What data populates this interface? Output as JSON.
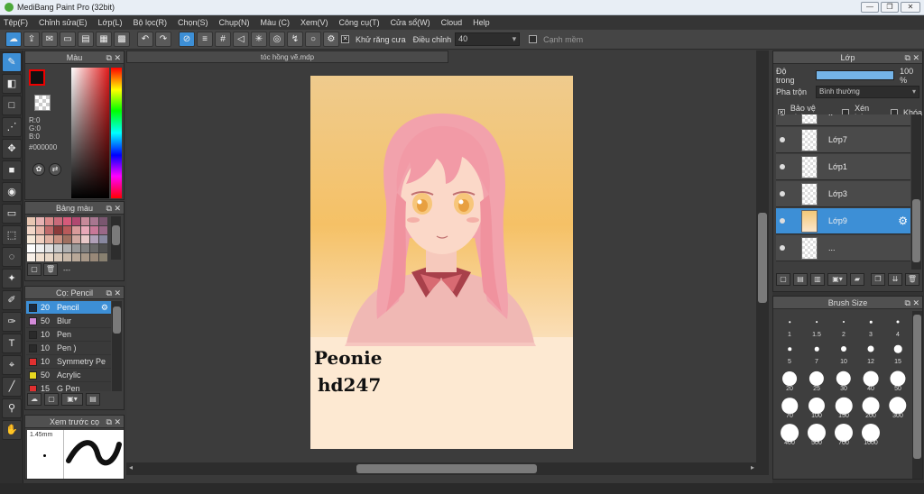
{
  "window": {
    "title": "MediBang Paint Pro (32bit)",
    "minimize": "—",
    "restore": "❐",
    "close": "✕"
  },
  "menu": [
    "Tệp(F)",
    "Chỉnh sửa(E)",
    "Lớp(L)",
    "Bộ lọc(R)",
    "Chọn(S)",
    "Chụp(N)",
    "Màu (C)",
    "Xem(V)",
    "Công cụ(T)",
    "Cửa sổ(W)",
    "Cloud",
    "Help"
  ],
  "toolbar": {
    "antialias_label": "Khử răng cưa",
    "correction_label": "Điều chỉnh",
    "correction_value": "40",
    "edge_label": "Cạnh mềm"
  },
  "color_panel": {
    "title": "Màu",
    "r": "R:0",
    "g": "G:0",
    "b": "B:0",
    "hex": "#000000"
  },
  "palette_panel": {
    "title": "Bảng màu",
    "dashes": "---",
    "swatches": [
      "#e8c7b3",
      "#e7b3b3",
      "#d98a8a",
      "#c96a7a",
      "#d65a7a",
      "#b04870",
      "#c78a9a",
      "#a87690",
      "#7a5670",
      "#f2d7c8",
      "#e8b5a8",
      "#c06a6a",
      "#8b3a3a",
      "#b85a5a",
      "#d89a9a",
      "#e8a8b8",
      "#c87898",
      "#9a6888",
      "#f6e8d8",
      "#f0d0c0",
      "#e0b0a0",
      "#c89080",
      "#a07060",
      "#d0a8a0",
      "#e8c8c8",
      "#b0a0b8",
      "#8888a0",
      "#ffffff",
      "#f0f0f0",
      "#e0e0e0",
      "#c8c8c8",
      "#b0b0b0",
      "#989898",
      "#808080",
      "#686868",
      "#505050",
      "#f8f0e8",
      "#f0e0d0",
      "#e8d8c8",
      "#d8c8b8",
      "#c8b8a8",
      "#b8a898",
      "#a89888",
      "#988878",
      "#888070"
    ]
  },
  "brush_panel": {
    "title": "Cọ: Pencil",
    "items": [
      {
        "size": "20",
        "name": "Pencil",
        "color": "#1a2a40"
      },
      {
        "size": "50",
        "name": "Blur",
        "color": "#d28ad8"
      },
      {
        "size": "10",
        "name": "Pen",
        "color": "#2a2a2a"
      },
      {
        "size": "10",
        "name": "Pen )",
        "color": "#2a2a2a"
      },
      {
        "size": "10",
        "name": "Symmetry Pe",
        "color": "#e03030"
      },
      {
        "size": "50",
        "name": "Acrylic",
        "color": "#e8d820"
      },
      {
        "size": "15",
        "name": "G Pen",
        "color": "#e03030"
      }
    ]
  },
  "preview_panel": {
    "title": "Xem trước cọ",
    "size": "1.45mm"
  },
  "document": {
    "tab": "tóc hồng vẽ.mdp",
    "signature_line1": "Peonie",
    "signature_line2": "hd247"
  },
  "layer_panel": {
    "title": "Lớp",
    "opacity_label": "Độ trong",
    "opacity_value": "100 %",
    "opacity": 1.0,
    "blend_label": "Pha trộn",
    "blend_value": "Bình thường",
    "protect_alpha": "Bảo vệ alpha",
    "clipping": "Xén bớt",
    "lock": "Khóa",
    "layers": [
      {
        "name": "..",
        "active": false
      },
      {
        "name": "Lớp7",
        "active": false
      },
      {
        "name": "Lớp1",
        "active": false
      },
      {
        "name": "Lớp3",
        "active": false
      },
      {
        "name": "Lớp9",
        "active": true
      },
      {
        "name": "...",
        "active": false
      }
    ]
  },
  "brush_size_panel": {
    "title": "Brush Size",
    "sizes": [
      "1",
      "1.5",
      "2",
      "3",
      "4",
      "5",
      "7",
      "10",
      "12",
      "15",
      "20",
      "25",
      "30",
      "40",
      "50",
      "70",
      "100",
      "150",
      "200",
      "300",
      "400",
      "500",
      "700",
      "1000"
    ]
  }
}
